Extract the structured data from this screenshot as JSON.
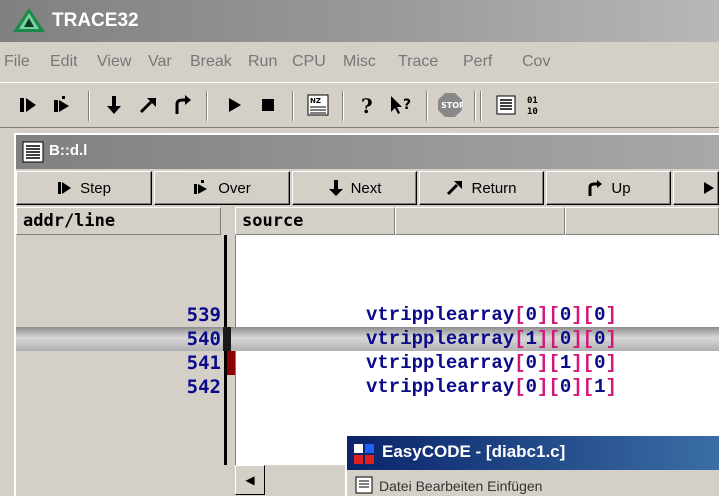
{
  "app": {
    "title": "TRACE32"
  },
  "menu": [
    "File",
    "Edit",
    "View",
    "Var",
    "Break",
    "Run",
    "CPU",
    "Misc",
    "Trace",
    "Perf",
    "Cov"
  ],
  "toolbar": {
    "icons": [
      "step-into-icon",
      "step-over-icon",
      "step-down-icon",
      "return-icon",
      "up-icon",
      "go-icon",
      "stop-icon",
      "register-icon",
      "help-icon",
      "context-help-icon",
      "stop-sign-icon",
      "list-icon",
      "hex-icon"
    ]
  },
  "debug_window": {
    "title": "B::d.l",
    "buttons": [
      {
        "label": "Step",
        "icon": "step-icon"
      },
      {
        "label": "Over",
        "icon": "over-icon"
      },
      {
        "label": "Next",
        "icon": "next-icon"
      },
      {
        "label": "Return",
        "icon": "return-icon"
      },
      {
        "label": "Up",
        "icon": "up-icon"
      }
    ],
    "columns": [
      "addr/line",
      "source"
    ],
    "rows": [
      {
        "line": "539",
        "tokens": [
          "vtripplearray",
          "[",
          "0",
          "]",
          "[",
          "0",
          "]",
          "[",
          "0",
          "]"
        ]
      },
      {
        "line": "540",
        "tokens": [
          "vtripplearray",
          "[",
          "1",
          "]",
          "[",
          "0",
          "]",
          "[",
          "0",
          "]"
        ],
        "current": true
      },
      {
        "line": "541",
        "tokens": [
          "vtripplearray",
          "[",
          "0",
          "]",
          "[",
          "1",
          "]",
          "[",
          "0",
          "]"
        ],
        "breakpoint": true
      },
      {
        "line": "542",
        "tokens": [
          "vtripplearray",
          "[",
          "0",
          "]",
          "[",
          "0",
          "]",
          "[",
          "1",
          "]"
        ]
      }
    ]
  },
  "easycode": {
    "title": "EasyCODE - [diabc1.c]",
    "menu_text": "Datei  Bearbeiten  Einfügen"
  },
  "colors": {
    "bracket": "#d4157a",
    "code": "#0b0b8a",
    "active_title": "#0a246a"
  }
}
